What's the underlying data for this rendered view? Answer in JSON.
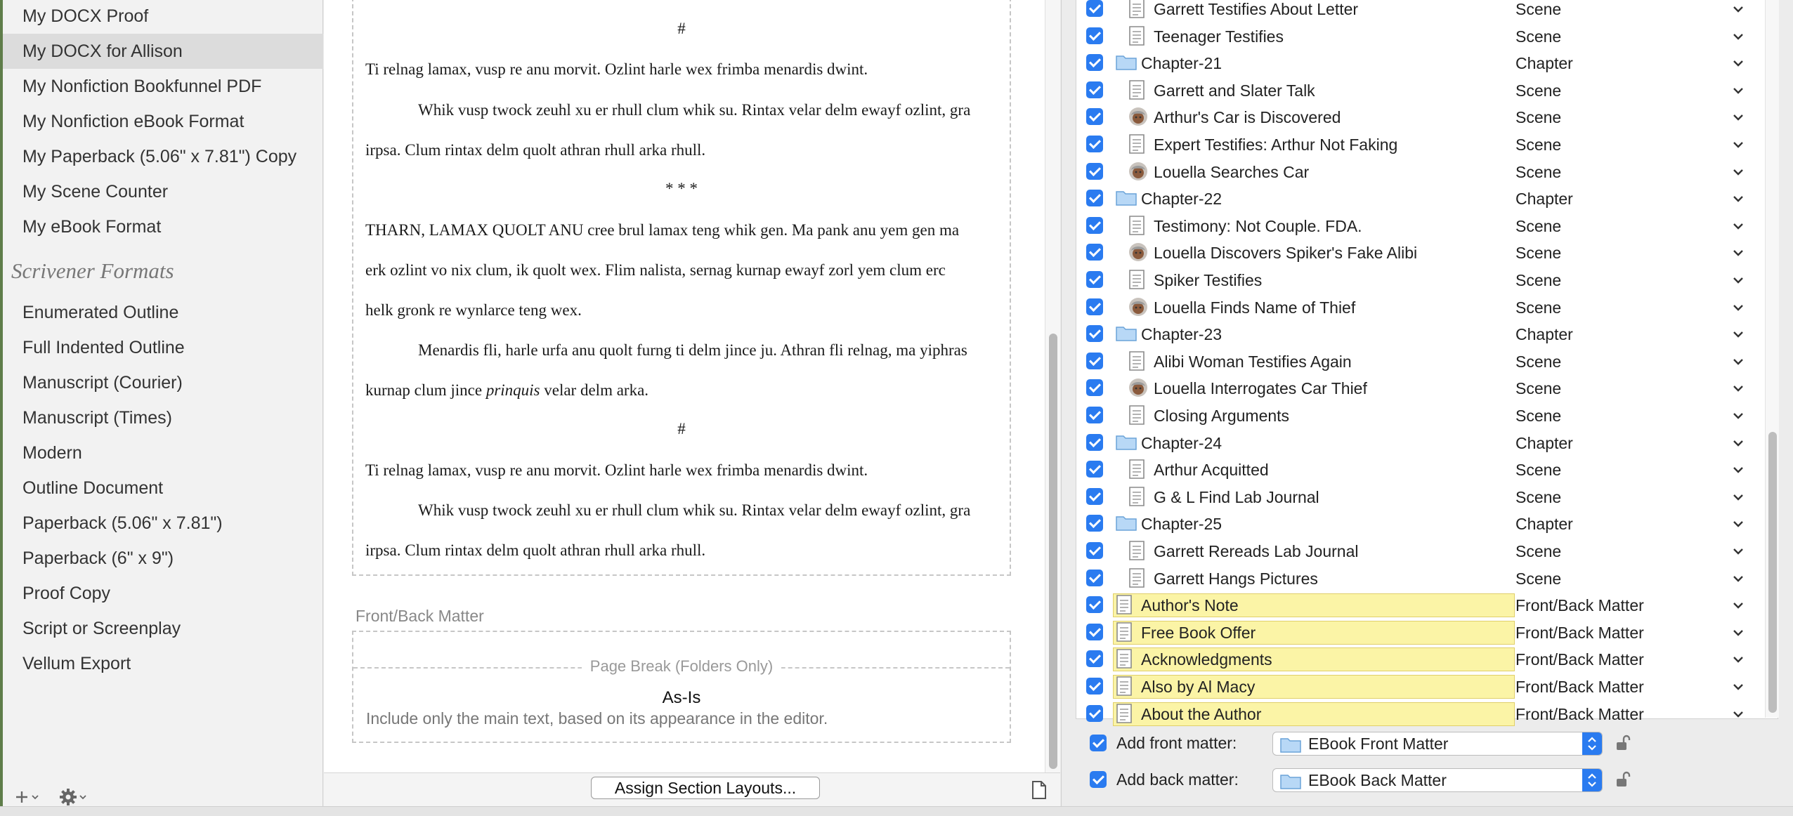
{
  "sidebar": {
    "items": [
      {
        "label": "My DOCX Proof"
      },
      {
        "label": "My DOCX for Allison",
        "selected": true
      },
      {
        "label": "My Nonfiction Bookfunnel PDF"
      },
      {
        "label": "My Nonfiction eBook Format"
      },
      {
        "label": "My Paperback (5.06\" x 7.81\") Copy"
      },
      {
        "label": "My Scene Counter"
      },
      {
        "label": "My eBook Format"
      }
    ],
    "heading": "Scrivener Formats",
    "formats": [
      {
        "label": "Enumerated Outline"
      },
      {
        "label": "Full Indented Outline"
      },
      {
        "label": "Manuscript (Courier)"
      },
      {
        "label": "Manuscript (Times)"
      },
      {
        "label": "Modern"
      },
      {
        "label": "Outline Document"
      },
      {
        "label": "Paperback (5.06\" x 7.81\")"
      },
      {
        "label": "Paperback (6\" x 9\")"
      },
      {
        "label": "Proof Copy"
      },
      {
        "label": "Script or Screenplay"
      },
      {
        "label": "Vellum Export"
      }
    ],
    "footer": {
      "add_icon": "plus-icon",
      "settings_icon": "gear-icon"
    }
  },
  "preview": {
    "sep1": "#",
    "p1": "Ti relnag lamax, vusp re anu morvit. Ozlint harle wex frimba menardis dwint.",
    "p2a": "Whik vusp twock zeuhl xu er rhull clum whik su. Rintax velar delm ewayf ozlint, gra",
    "p2b": "irpsa. Clum rintax delm quolt athran rhull arka rhull.",
    "sep2": "* * *",
    "p3a": "THARN, LAMAX QUOLT ANU cree brul lamax teng whik gen. Ma pank anu yem gen ma",
    "p3b": "erk ozlint vo nix clum, ik quolt wex. Flim nalista, sernag kurnap ewayf zorl yem clum erc",
    "p3c": "helk gronk re wynlarce teng wex.",
    "p4a": "Menardis fli, harle urfa anu quolt furng ti delm jince ju. Athran fli relnag, ma yiphras",
    "p4b_pre": "kurnap clum jince ",
    "p4b_em": "prinquis",
    "p4b_post": " velar delm arka.",
    "sep3": "#",
    "p5": "Ti relnag lamax, vusp re anu morvit. Ozlint harle wex frimba menardis dwint.",
    "p6a": "Whik vusp twock zeuhl xu er rhull clum whik su. Rintax velar delm ewayf ozlint, gra",
    "p6b": "irpsa. Clum rintax delm quolt athran rhull arka rhull."
  },
  "front_back": {
    "label": "Front/Back Matter",
    "page_break": "Page Break (Folders Only)",
    "layout_title": "As-Is",
    "layout_desc": "Include only the main text, based on its appearance in the editor."
  },
  "assign_button": "Assign Section Layouts...",
  "contents": [
    {
      "title": "Garrett Testifies About Letter",
      "type": "Scene",
      "icon": "document-icon",
      "level": 2
    },
    {
      "title": "Teenager Testifies",
      "type": "Scene",
      "icon": "document-icon",
      "level": 2
    },
    {
      "title": "Chapter-21",
      "type": "Chapter",
      "icon": "folder-icon",
      "level": 1
    },
    {
      "title": "Garrett and Slater Talk",
      "type": "Scene",
      "icon": "document-icon",
      "level": 2
    },
    {
      "title": "Arthur's Car is Discovered",
      "type": "Scene",
      "icon": "character-icon",
      "level": 2
    },
    {
      "title": "Expert Testifies: Arthur Not Faking",
      "type": "Scene",
      "icon": "document-icon",
      "level": 2
    },
    {
      "title": "Louella Searches Car",
      "type": "Scene",
      "icon": "character-icon",
      "level": 2
    },
    {
      "title": "Chapter-22",
      "type": "Chapter",
      "icon": "folder-icon",
      "level": 1
    },
    {
      "title": "Testimony: Not Couple. FDA.",
      "type": "Scene",
      "icon": "document-icon",
      "level": 2
    },
    {
      "title": "Louella Discovers Spiker's Fake Alibi",
      "type": "Scene",
      "icon": "character-icon",
      "level": 2
    },
    {
      "title": "Spiker Testifies",
      "type": "Scene",
      "icon": "document-icon",
      "level": 2
    },
    {
      "title": "Louella Finds Name of Thief",
      "type": "Scene",
      "icon": "character-icon",
      "level": 2
    },
    {
      "title": "Chapter-23",
      "type": "Chapter",
      "icon": "folder-icon",
      "level": 1
    },
    {
      "title": "Alibi Woman Testifies Again",
      "type": "Scene",
      "icon": "document-icon",
      "level": 2
    },
    {
      "title": "Louella Interrogates Car Thief",
      "type": "Scene",
      "icon": "character-icon",
      "level": 2
    },
    {
      "title": "Closing Arguments",
      "type": "Scene",
      "icon": "document-icon",
      "level": 2
    },
    {
      "title": "Chapter-24",
      "type": "Chapter",
      "icon": "folder-icon",
      "level": 1
    },
    {
      "title": "Arthur Acquitted",
      "type": "Scene",
      "icon": "document-icon",
      "level": 2
    },
    {
      "title": "G & L Find Lab Journal",
      "type": "Scene",
      "icon": "document-icon",
      "level": 2
    },
    {
      "title": "Chapter-25",
      "type": "Chapter",
      "icon": "folder-icon",
      "level": 1
    },
    {
      "title": "Garrett Rereads Lab Journal",
      "type": "Scene",
      "icon": "document-icon",
      "level": 2
    },
    {
      "title": "Garrett Hangs Pictures",
      "type": "Scene",
      "icon": "document-icon",
      "level": 2
    },
    {
      "title": "Author's Note",
      "type": "Front/Back Matter",
      "icon": "document-icon",
      "level": 1,
      "highlight": true
    },
    {
      "title": "Free Book Offer",
      "type": "Front/Back Matter",
      "icon": "document-icon",
      "level": 1,
      "highlight": true
    },
    {
      "title": "Acknowledgments",
      "type": "Front/Back Matter",
      "icon": "document-icon",
      "level": 1,
      "highlight": true
    },
    {
      "title": "Also by Al Macy",
      "type": "Front/Back Matter",
      "icon": "document-icon",
      "level": 1,
      "highlight": true
    },
    {
      "title": "About the Author",
      "type": "Front/Back Matter",
      "icon": "document-icon",
      "level": 1,
      "highlight": true
    }
  ],
  "matter": {
    "front_label": "Add front matter:",
    "front_value": "EBook Front Matter",
    "back_label": "Add back matter:",
    "back_value": "EBook Back Matter"
  },
  "colors": {
    "accent": "#2a7bf0",
    "highlight": "#fbf4a6",
    "sidebar_selected": "#dcdcdc"
  }
}
